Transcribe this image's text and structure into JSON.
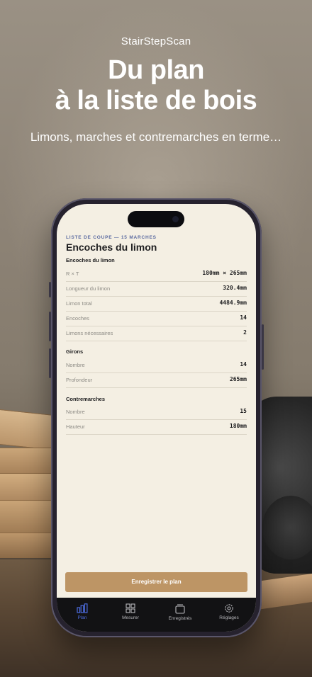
{
  "header": {
    "app_name": "StairStepScan",
    "headline_line1": "Du plan",
    "headline_line2": "à la liste de bois",
    "subtitle": "Limons, marches et contremarches en terme…"
  },
  "screen": {
    "eyebrow": "LISTE DE COUPE — 15 MARCHES",
    "title": "Encoches du limon",
    "sections": [
      {
        "heading": "Encoches du limon",
        "rows": [
          {
            "label": "R × T",
            "value": "180mm × 265mm"
          },
          {
            "label": "Longueur du limon",
            "value": "320.4mm"
          },
          {
            "label": "Limon total",
            "value": "4484.9mm"
          },
          {
            "label": "Encoches",
            "value": "14"
          },
          {
            "label": "Limons nécessaires",
            "value": "2"
          }
        ]
      },
      {
        "heading": "Girons",
        "rows": [
          {
            "label": "Nombre",
            "value": "14"
          },
          {
            "label": "Profondeur",
            "value": "265mm"
          }
        ]
      },
      {
        "heading": "Contremarches",
        "rows": [
          {
            "label": "Nombre",
            "value": "15"
          },
          {
            "label": "Hauteur",
            "value": "180mm"
          }
        ]
      }
    ],
    "save_button": "Enregistrer le plan"
  },
  "tabbar": {
    "tabs": [
      {
        "label": "Plan",
        "icon": "bar-chart-icon",
        "active": true
      },
      {
        "label": "Mesurer",
        "icon": "grid-icon",
        "active": false
      },
      {
        "label": "Enregistrés",
        "icon": "archive-icon",
        "active": false
      },
      {
        "label": "Réglages",
        "icon": "gear-icon",
        "active": false
      }
    ]
  },
  "colors": {
    "accent": "#4d6cdf",
    "button": "#bd9565",
    "screen_bg": "#f4efe3"
  }
}
